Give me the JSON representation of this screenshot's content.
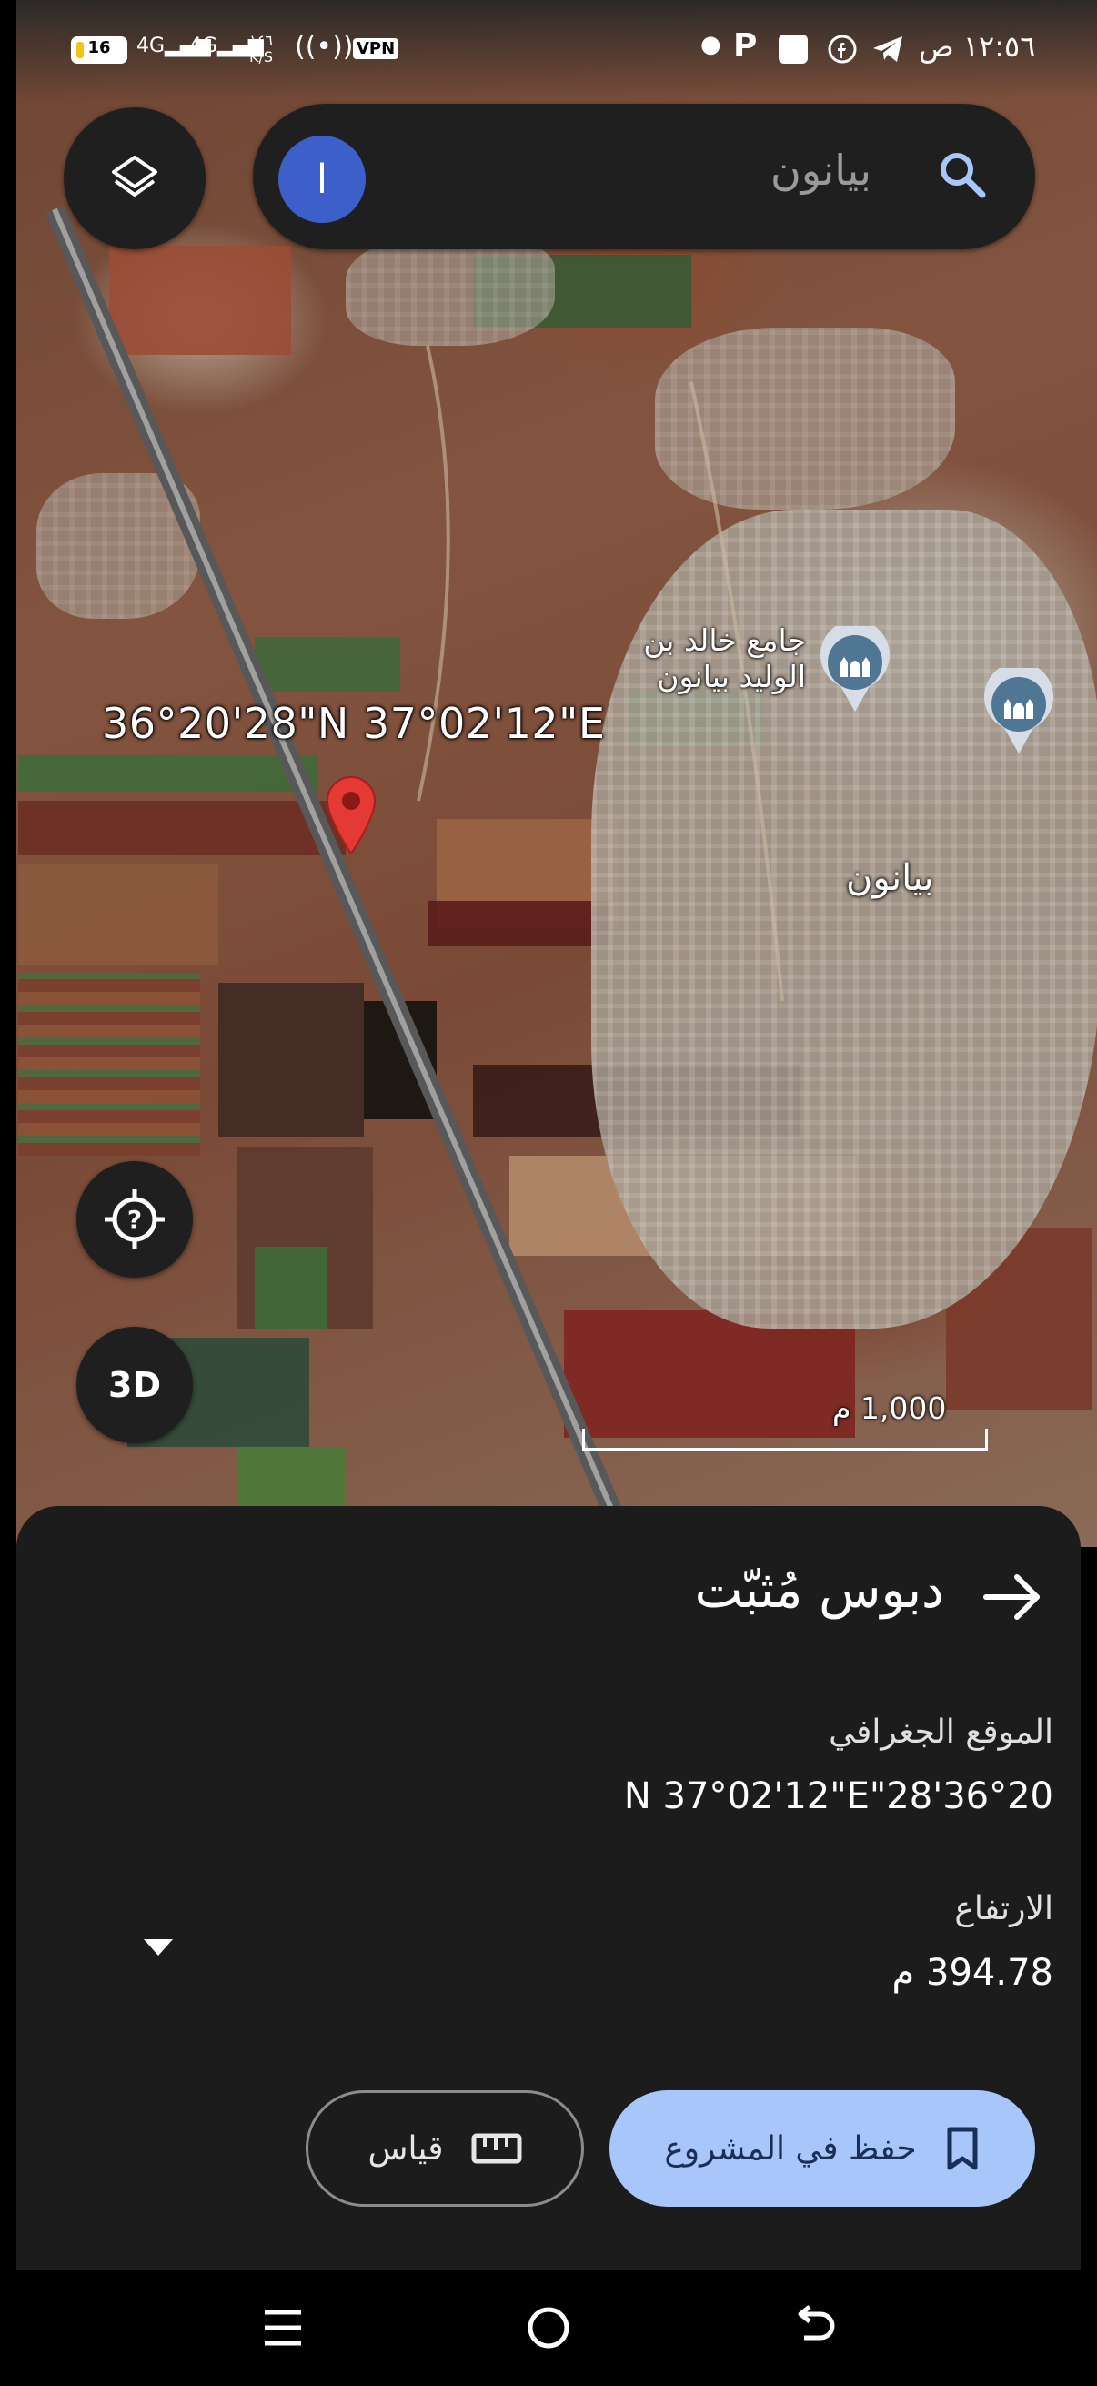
{
  "status_bar": {
    "time": "١٢:٥٦ ص",
    "battery_text": "16",
    "battery_level": 0.16,
    "network_1": "4G",
    "network_2": "4G",
    "speed_value": "١٤٦",
    "speed_unit": "K/S",
    "vpn": "VPN",
    "p_icon": "P"
  },
  "search": {
    "avatar_letter": "ا",
    "query": "بيانون"
  },
  "map": {
    "coordinates_label": "36°20'28\"N 37°02'12\"E",
    "poi_mosque_line1": "جامع خالد بن",
    "poi_mosque_line2": "الوليد بيانون",
    "town_label": "بيانون",
    "btn_3d": "3D",
    "scale_text": "1,000 م",
    "colors": {
      "pin": "#e53935",
      "poi": "#d7dde6"
    }
  },
  "sheet": {
    "title": "دبوس مُثبّت",
    "location_label": "الموقع الجغرافي",
    "location_value": "N 37°02'12\"E\"28'36°20",
    "elevation_label": "الارتفاع",
    "elevation_value": "394.78 م",
    "save_label": "حفظ في المشروع",
    "measure_label": "قياس",
    "colors": {
      "save_bg": "#a8c6fa",
      "sheet_bg": "#1c1c1c"
    }
  },
  "icons": {
    "layers": "layers-icon",
    "search": "search-icon",
    "help_location": "help-location-icon",
    "back": "arrow-right-icon",
    "bookmark": "bookmark-icon",
    "ruler": "ruler-icon",
    "collapse": "triangle-down-icon",
    "nav_menu": "menu-icon",
    "nav_home": "home-circle-icon",
    "nav_back": "back-icon"
  }
}
